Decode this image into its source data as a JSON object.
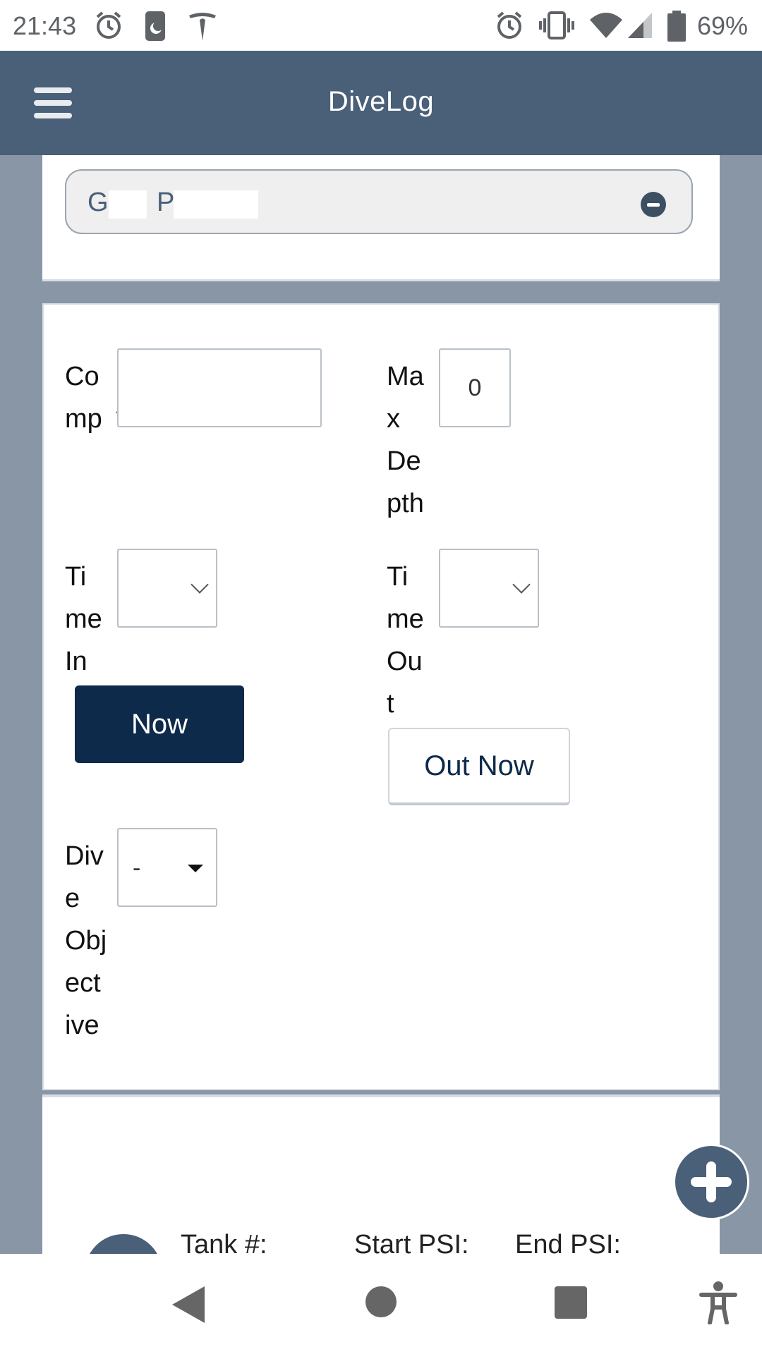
{
  "status_bar": {
    "time": "21:43",
    "battery": "69%",
    "icons_left": [
      "alarm-icon",
      "do-not-disturb-icon",
      "tesla-icon"
    ],
    "icons_right": [
      "alarm-icon",
      "vibrate-icon",
      "wifi-icon",
      "signal-icon",
      "battery-icon"
    ]
  },
  "header": {
    "title": "DiveLog",
    "menu_icon": "hamburger-menu-icon"
  },
  "diver": {
    "initial_first": "G",
    "initial_last": "P",
    "remove_icon": "minus-circle-icon"
  },
  "form": {
    "comp_label": "Comp",
    "comp_label_lines": [
      "Co",
      "mp"
    ],
    "comp_required": "*",
    "comp_value": "",
    "max_depth_label": "Max Depth",
    "max_depth_label_lines": [
      "Ma",
      "x",
      "De",
      "pth"
    ],
    "max_depth_value": "0",
    "time_in_label": "Time In",
    "time_in_label_lines": [
      "Ti",
      "me",
      "In"
    ],
    "time_in_value": "",
    "time_out_label": "Time Out",
    "time_out_label_lines": [
      "Ti",
      "me",
      "Ou",
      "t"
    ],
    "time_out_value": "",
    "now_button": "Now",
    "out_now_button": "Out Now",
    "dive_objective_label": "Dive Objective",
    "dive_objective_label_lines": [
      "Div",
      "e",
      "Obj",
      "ect",
      "ive"
    ],
    "dive_objective_value": "-"
  },
  "tanks": {
    "col_tank": "Tank #:",
    "col_start_psi": "Start PSI:",
    "col_end_psi": "End PSI:",
    "add_icon": "plus-icon"
  },
  "colors": {
    "header_bg": "#4a5f78",
    "primary_button": "#0d2a4a",
    "page_bg": "#8896a6",
    "required": "#c0211f"
  }
}
